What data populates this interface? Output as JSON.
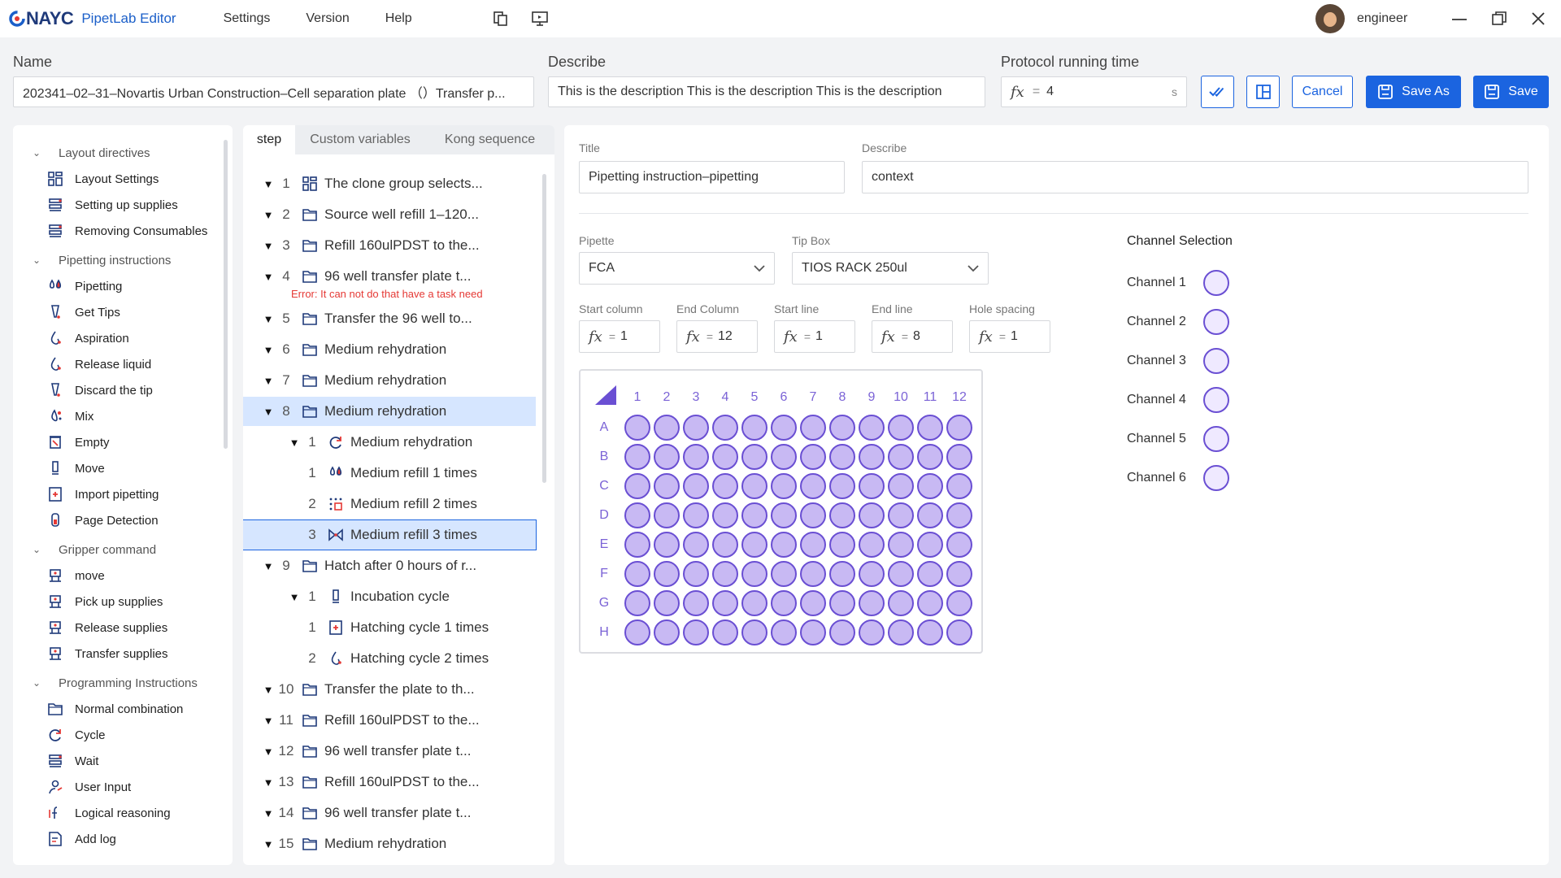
{
  "app": {
    "brand": "NAYC",
    "title": "PipetLab Editor",
    "menu": [
      "Settings",
      "Version",
      "Help"
    ],
    "user": "engineer"
  },
  "header": {
    "name_label": "Name",
    "name_value": "202341–02–31–Novartis Urban Construction–Cell separation plate （）Transfer p...",
    "describe_label": "Describe",
    "describe_value": "This is the description This is the description This is the description",
    "time_label": "Protocol running time",
    "time_value": "4",
    "time_unit": "s",
    "fx": "fx",
    "eq": "=",
    "cancel": "Cancel",
    "save_as": "Save As",
    "save": "Save"
  },
  "sidebar": {
    "groups": [
      {
        "label": "Layout directives",
        "items": [
          {
            "label": "Layout Settings",
            "icon": "grid-icon"
          },
          {
            "label": "Setting up supplies",
            "icon": "rack-icon"
          },
          {
            "label": "Removing Consumables",
            "icon": "rack-icon"
          }
        ]
      },
      {
        "label": "Pipetting instructions",
        "items": [
          {
            "label": "Pipetting",
            "icon": "drops-icon"
          },
          {
            "label": "Get Tips",
            "icon": "tip-icon"
          },
          {
            "label": "Aspiration",
            "icon": "drop-icon"
          },
          {
            "label": "Release liquid",
            "icon": "drop-icon"
          },
          {
            "label": "Discard the tip",
            "icon": "tip-icon"
          },
          {
            "label": "Mix",
            "icon": "mix-icon"
          },
          {
            "label": "Empty",
            "icon": "empty-icon"
          },
          {
            "label": "Move",
            "icon": "move-icon"
          },
          {
            "label": "Import pipetting",
            "icon": "import-icon"
          },
          {
            "label": "Page Detection",
            "icon": "detect-icon"
          }
        ]
      },
      {
        "label": "Gripper command",
        "items": [
          {
            "label": "move",
            "icon": "gripper-icon"
          },
          {
            "label": "Pick up supplies",
            "icon": "gripper-icon"
          },
          {
            "label": "Release supplies",
            "icon": "gripper-icon"
          },
          {
            "label": "Transfer supplies",
            "icon": "gripper-icon"
          }
        ]
      },
      {
        "label": "Programming Instructions",
        "items": [
          {
            "label": "Normal combination",
            "icon": "folder-icon"
          },
          {
            "label": "Cycle",
            "icon": "cycle-icon"
          },
          {
            "label": "Wait",
            "icon": "rack-icon"
          },
          {
            "label": "User Input",
            "icon": "user-icon"
          },
          {
            "label": "Logical reasoning",
            "icon": "logic-icon"
          },
          {
            "label": "Add log",
            "icon": "log-icon"
          }
        ]
      }
    ]
  },
  "tree": {
    "tabs": [
      "step",
      "Custom variables",
      "Kong sequence"
    ],
    "rows": [
      {
        "num": "1",
        "label": "The clone group selects...",
        "level": 0,
        "icon": "grid-icon",
        "expand": true
      },
      {
        "num": "2",
        "label": "Source well refill 1–120...",
        "level": 0,
        "icon": "folder-icon",
        "expand": true
      },
      {
        "num": "3",
        "label": "Refill 160ulPDST to the...",
        "level": 0,
        "icon": "folder-icon",
        "expand": true
      },
      {
        "num": "4",
        "label": "96 well transfer plate t...",
        "level": 0,
        "icon": "folder-icon",
        "expand": true,
        "error": "Error: It can not do that have a task need"
      },
      {
        "num": "5",
        "label": "Transfer the 96 well to...",
        "level": 0,
        "icon": "folder-icon",
        "expand": true
      },
      {
        "num": "6",
        "label": "Medium rehydration",
        "level": 0,
        "icon": "folder-icon",
        "expand": true
      },
      {
        "num": "7",
        "label": "Medium rehydration",
        "level": 0,
        "icon": "folder-icon",
        "expand": true
      },
      {
        "num": "8",
        "label": "Medium rehydration",
        "level": 0,
        "icon": "folder-icon",
        "expand": true,
        "selected": true
      },
      {
        "num": "1",
        "label": "Medium rehydration",
        "level": 1,
        "icon": "cycle-icon",
        "expand": true
      },
      {
        "num": "1",
        "label": "Medium refill 1 times",
        "level": 1,
        "icon": "drops-icon"
      },
      {
        "num": "2",
        "label": "Medium refill 2 times",
        "level": 1,
        "icon": "dots-icon"
      },
      {
        "num": "3",
        "label": "Medium refill 3 times",
        "level": 1,
        "icon": "transfer-icon",
        "active": true
      },
      {
        "num": "9",
        "label": "Hatch after 0 hours of r...",
        "level": 0,
        "icon": "folder-icon",
        "expand": true
      },
      {
        "num": "1",
        "label": "Incubation cycle",
        "level": 1,
        "icon": "move-icon",
        "expand": true
      },
      {
        "num": "1",
        "label": "Hatching cycle 1 times",
        "level": 1,
        "icon": "import-icon"
      },
      {
        "num": "2",
        "label": "Hatching cycle 2 times",
        "level": 1,
        "icon": "drop-icon"
      },
      {
        "num": "10",
        "label": "Transfer the plate to th...",
        "level": 0,
        "icon": "folder-icon",
        "expand": true
      },
      {
        "num": "11",
        "label": "Refill 160ulPDST to the...",
        "level": 0,
        "icon": "folder-icon",
        "expand": true
      },
      {
        "num": "12",
        "label": "96 well transfer plate t...",
        "level": 0,
        "icon": "folder-icon",
        "expand": true
      },
      {
        "num": "13",
        "label": "Refill 160ulPDST to the...",
        "level": 0,
        "icon": "folder-icon",
        "expand": true
      },
      {
        "num": "14",
        "label": "96 well transfer plate t...",
        "level": 0,
        "icon": "folder-icon",
        "expand": true
      },
      {
        "num": "15",
        "label": "Medium rehydration",
        "level": 0,
        "icon": "folder-icon",
        "expand": true
      }
    ]
  },
  "main": {
    "title_label": "Title",
    "title_value": "Pipetting instruction–pipetting",
    "describe_label": "Describe",
    "describe_value": "context",
    "pipette_label": "Pipette",
    "pipette_value": "FCA",
    "tipbox_label": "Tip Box",
    "tipbox_value": "TIOS RACK 250ul",
    "params": [
      {
        "label": "Start column",
        "value": "1"
      },
      {
        "label": "End Column",
        "value": "12"
      },
      {
        "label": "Start line",
        "value": "1"
      },
      {
        "label": "End line",
        "value": "8"
      },
      {
        "label": "Hole spacing",
        "value": "1"
      }
    ],
    "plate": {
      "columns": [
        "1",
        "2",
        "3",
        "4",
        "5",
        "6",
        "7",
        "8",
        "9",
        "10",
        "11",
        "12"
      ],
      "rows": [
        "A",
        "B",
        "C",
        "D",
        "E",
        "F",
        "G",
        "H"
      ]
    },
    "channels_title": "Channel Selection",
    "channels": [
      "Channel 1",
      "Channel 2",
      "Channel 3",
      "Channel 4",
      "Channel 5",
      "Channel 6"
    ]
  },
  "colors": {
    "primary": "#1b64e0",
    "well_fill": "#c8b9f3",
    "well_stroke": "#6a4fd3",
    "error": "#e53935",
    "selected_row": "#d6e6ff"
  }
}
